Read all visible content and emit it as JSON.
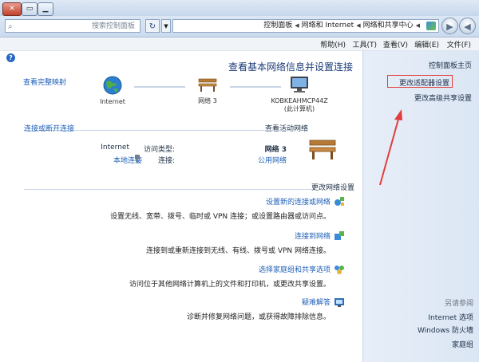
{
  "window": {
    "close_glyph": "✕",
    "max_glyph": "▭",
    "min_glyph": "▁"
  },
  "address": {
    "search_placeholder": "搜索控制面板",
    "search_icon_glyph": "⌕",
    "refresh_glyph": "↻",
    "dropdown_glyph": "▼",
    "breadcrumbs": [
      "控制面板",
      "网络和 Internet",
      "网络和共享中心"
    ],
    "back_glyph": "◀",
    "forward_glyph": "▶"
  },
  "menu": {
    "items": [
      "文件(F)",
      "编辑(E)",
      "查看(V)",
      "工具(T)",
      "帮助(H)"
    ]
  },
  "sidebar": {
    "links": [
      "控制面板主页",
      "更改适配器设置",
      "更改高级共享设置"
    ],
    "see_also_label": "另请参阅",
    "see_also": [
      "Internet 选项",
      "Windows 防火墙",
      "家庭组"
    ]
  },
  "main": {
    "help_glyph": "?",
    "title": "查看基本网络信息并设置连接",
    "full_map_link": "查看完整映射",
    "computer_name": "KOBKEAHMCP44Z",
    "computer_sub": "(此计算机)",
    "network_name": "网络 3",
    "internet_label": "Internet",
    "active_section": "查看活动网络",
    "connect_disconnect": "连接或断开连接",
    "active_network": {
      "name": "网络 3",
      "type": "公用网络",
      "access_type_label": "访问类型:",
      "access_type_value": "Internet",
      "connections_label": "连接:",
      "connections_value": "本地连接"
    },
    "change_section": "更改网络设置",
    "tasks": [
      {
        "link": "设置新的连接或网络",
        "desc": "设置无线、宽带、拨号、临时或 VPN 连接；或设置路由器或访问点。"
      },
      {
        "link": "连接到网络",
        "desc": "连接到或重新连接到无线、有线、拨号或 VPN 网络连接。"
      },
      {
        "link": "选择家庭组和共享选项",
        "desc": "访问位于其他网络计算机上的文件和打印机，或更改共享设置。"
      },
      {
        "link": "疑难解答",
        "desc": "诊断并修复网络问题，或获得故障排除信息。"
      }
    ]
  },
  "colors": {
    "accent_link": "#1f60b8",
    "title_blue": "#1a3a78",
    "highlight_red": "#e23d3d"
  }
}
